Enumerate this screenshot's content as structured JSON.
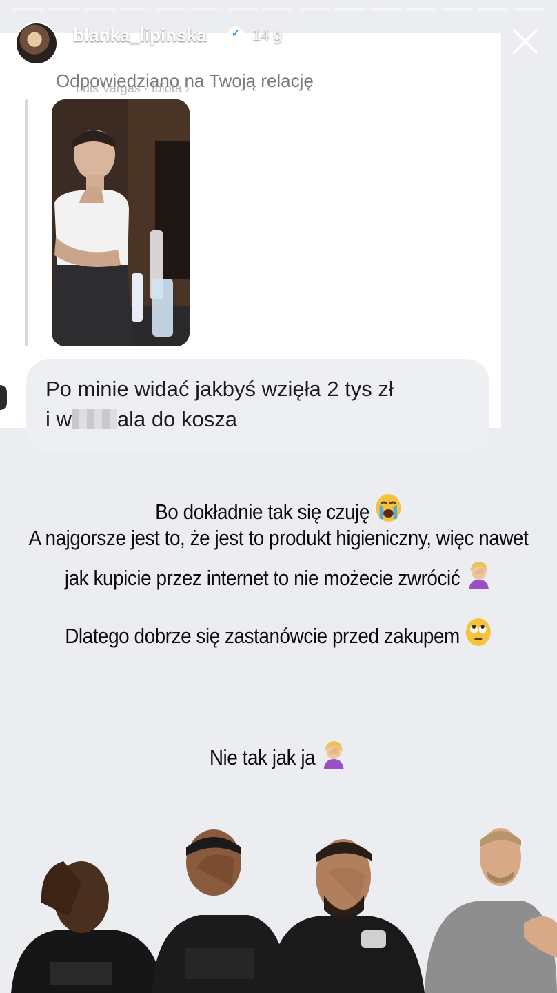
{
  "story": {
    "progress_segments": 15,
    "progress_done": 9
  },
  "header": {
    "username": "blanka_lipinska",
    "time": "14 g",
    "verified_icon": "verified-badge-icon",
    "close_icon": "close-icon"
  },
  "reply_card": {
    "reply_hint": "Odpowiedziano na Twoją relację",
    "reply_sub": "Luis Vargas · Idiota ›",
    "message_part1": "Po minie widać jakbyś wzięła 2 tys zł",
    "message_part2_start": "i w",
    "message_part2_end": "ala do kosza"
  },
  "caption": {
    "line1": "Bo dokładnie tak się czuję",
    "line2": "A najgorsze jest to, że jest to produkt higieniczny, więc nawet",
    "line3": "jak kupicie przez internet to nie możecie zwrócić",
    "line4": "Dlatego dobrze się zastanówcie przed zakupem",
    "line5": "Nie tak jak ja"
  },
  "colors": {
    "background": "#ecedf1",
    "bubble": "#eeeff2",
    "card": "#ffffff",
    "text": "#0c0c0c"
  }
}
